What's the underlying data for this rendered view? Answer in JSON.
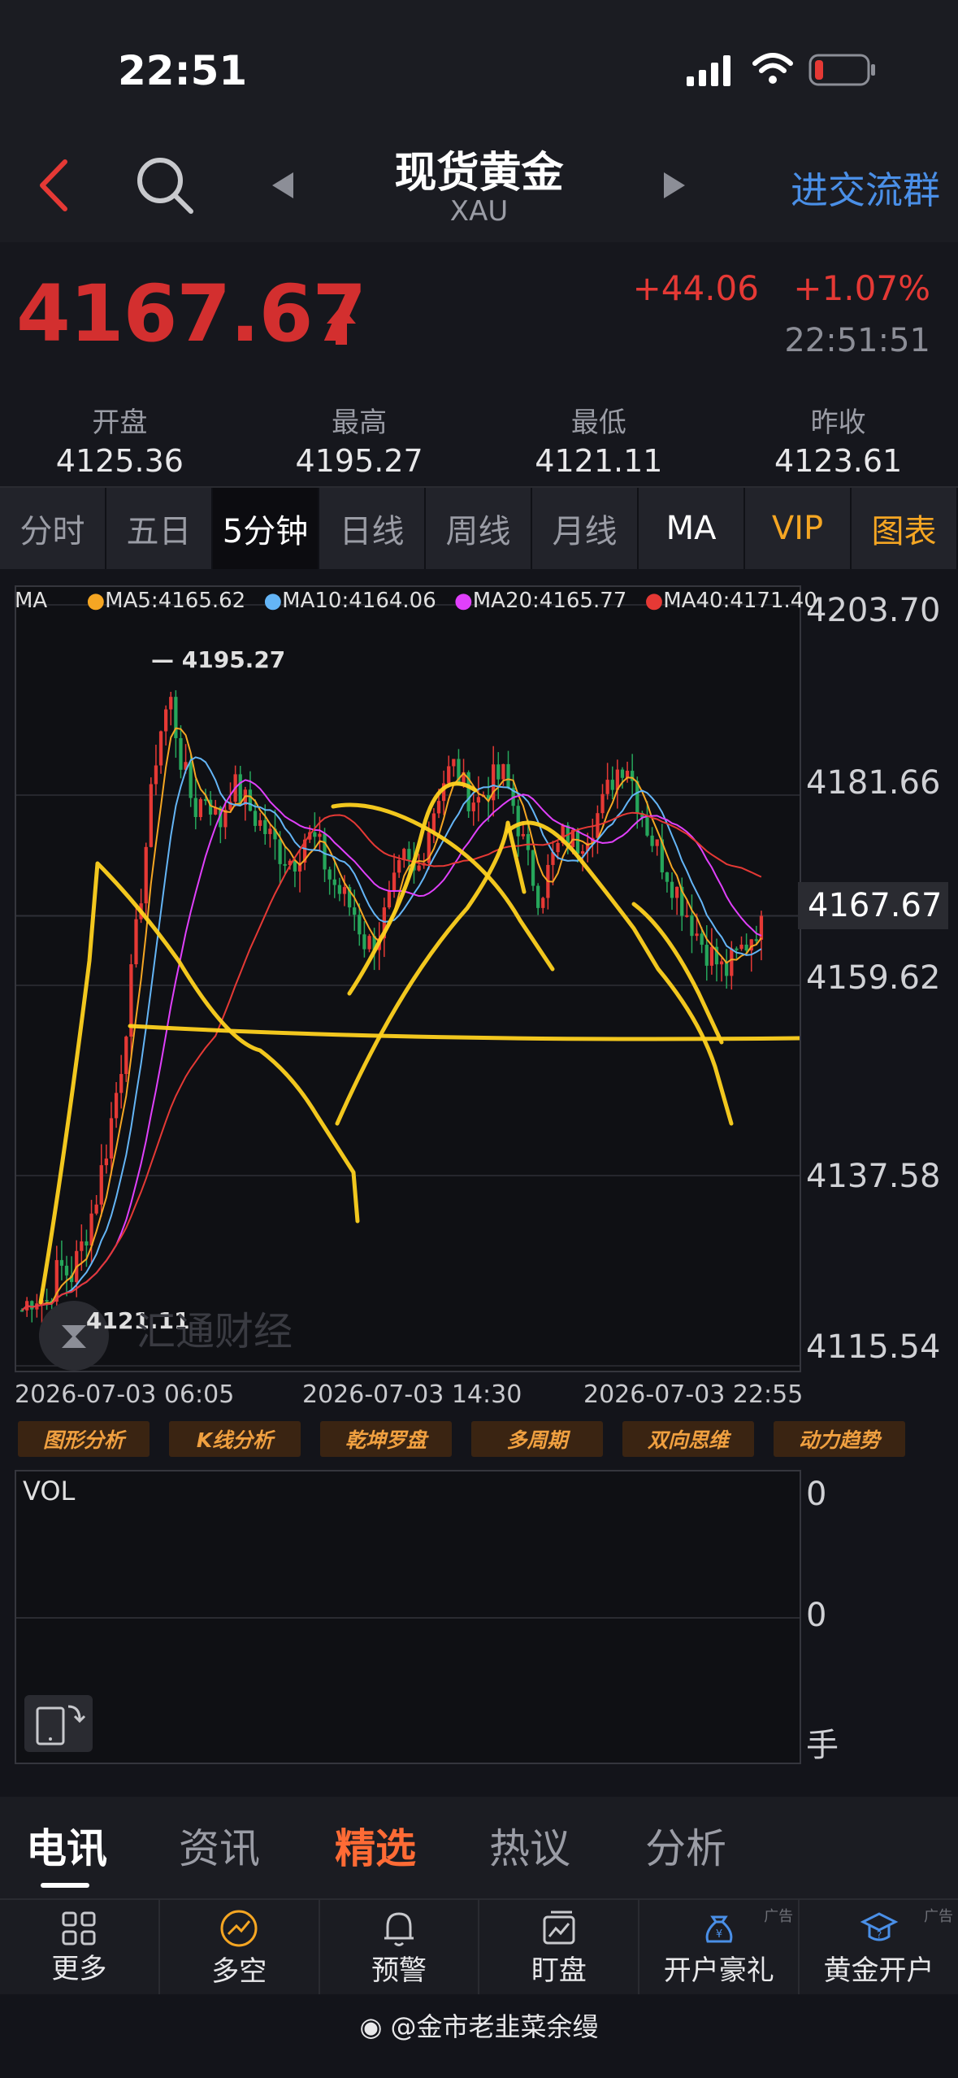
{
  "status": {
    "time": "22:51"
  },
  "nav": {
    "title": "现货黄金",
    "subtitle": "XAU",
    "join_label": "进交流群"
  },
  "quote": {
    "price": "4167.67",
    "change": "+44.06",
    "change_pct": "+1.07%",
    "time": "22:51:51"
  },
  "stats": [
    {
      "label": "开盘",
      "value": "4125.36"
    },
    {
      "label": "最高",
      "value": "4195.27"
    },
    {
      "label": "最低",
      "value": "4121.11"
    },
    {
      "label": "昨收",
      "value": "4123.61"
    }
  ],
  "tabs": [
    "分时",
    "五日",
    "5分钟",
    "日线",
    "周线",
    "月线",
    "MA",
    "VIP",
    "图表"
  ],
  "chart": {
    "ma_label": "MA",
    "ma5": "MA5:4165.62",
    "ma10": "MA10:4164.06",
    "ma20": "MA20:4165.77",
    "ma40": "MA40:4171.40",
    "high_marker": "4195.27",
    "low_marker": "4121.11",
    "watermark": "汇通财经",
    "current_price": "4167.67"
  },
  "chart_data": {
    "type": "line",
    "title": "",
    "xlabel": "",
    "ylabel": "",
    "x": [
      "2026-07-03 06:05",
      "2026-07-03 14:30",
      "2026-07-03 22:55"
    ],
    "y_ticks": [
      "4203.70",
      "4181.66",
      "4159.62",
      "4137.58",
      "4115.54"
    ],
    "ylim": [
      4115.54,
      4203.7
    ],
    "grid": true,
    "series": [
      {
        "name": "MA5:4165.62",
        "color": "#f5a623"
      },
      {
        "name": "MA10:4164.06",
        "color": "#64b5f6"
      },
      {
        "name": "MA20:4165.77",
        "color": "#e040fb"
      },
      {
        "name": "MA40:4171.40",
        "color": "#e53935"
      }
    ],
    "approx_close": [
      4122,
      4124,
      4123,
      4127,
      4126,
      4130,
      4135,
      4142,
      4150,
      4162,
      4175,
      4188,
      4193,
      4185,
      4180,
      4182,
      4178,
      4183,
      4181,
      4179,
      4177,
      4175,
      4174,
      4177,
      4176,
      4172,
      4170,
      4168,
      4164,
      4166,
      4170,
      4174,
      4172,
      4178,
      4183,
      4185,
      4182,
      4181,
      4183,
      4184,
      4180,
      4174,
      4170,
      4174,
      4177,
      4176,
      4178,
      4180,
      4184,
      4186,
      4181,
      4177,
      4174,
      4171,
      4168,
      4165,
      4163,
      4161,
      4163,
      4165,
      4167.67
    ]
  },
  "analysis_tools": [
    "图形分析",
    "K线分析",
    "乾坤罗盘",
    "多周期",
    "双向思维",
    "动力趋势"
  ],
  "volume": {
    "label": "VOL",
    "top": "0",
    "mid": "0",
    "unit": "手"
  },
  "news_tabs": [
    "电讯",
    "资讯",
    "精选",
    "热议",
    "分析"
  ],
  "bottom_bar": [
    {
      "label": "更多",
      "ad": ""
    },
    {
      "label": "多空",
      "ad": ""
    },
    {
      "label": "预警",
      "ad": ""
    },
    {
      "label": "盯盘",
      "ad": ""
    },
    {
      "label": "开户豪礼",
      "ad": "广告"
    },
    {
      "label": "黄金开户",
      "ad": "广告"
    }
  ],
  "footer": {
    "text": "@金市老韭菜余缦"
  }
}
